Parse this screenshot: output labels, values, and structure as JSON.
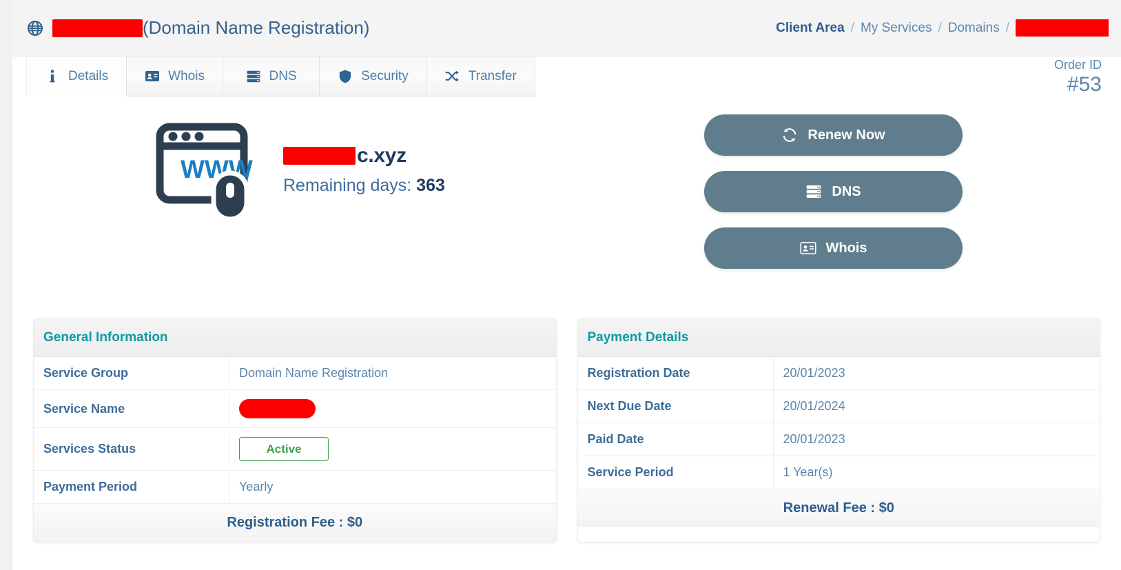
{
  "header": {
    "globe_icon": "globe-icon",
    "title_redacted": true,
    "title_suffix": "(Domain Name Registration)",
    "breadcrumb": {
      "items": [
        {
          "label": "Client Area",
          "strong": true
        },
        {
          "label": "My Services",
          "strong": false
        },
        {
          "label": "Domains",
          "strong": false
        }
      ],
      "separator": "/",
      "last_redacted": true
    }
  },
  "tabs": [
    {
      "label": "Details",
      "icon": "info-icon",
      "active": true
    },
    {
      "label": "Whois",
      "icon": "id-card-icon",
      "active": false
    },
    {
      "label": "DNS",
      "icon": "server-icon",
      "active": false
    },
    {
      "label": "Security",
      "icon": "shield-icon",
      "active": false
    },
    {
      "label": "Transfer",
      "icon": "shuffle-icon",
      "active": false
    }
  ],
  "order": {
    "label": "Order ID",
    "value": "#53"
  },
  "hero": {
    "www_icon": "www-browser-mouse-icon",
    "domain_suffix": "c.xyz",
    "remaining_label": "Remaining days:",
    "remaining_value": "363",
    "actions": [
      {
        "label": "Renew Now",
        "icon": "refresh-icon"
      },
      {
        "label": "DNS",
        "icon": "server-icon"
      },
      {
        "label": "Whois",
        "icon": "id-card-icon"
      }
    ]
  },
  "general_information": {
    "title": "General Information",
    "rows": [
      {
        "label": "Service Group",
        "value": "Domain Name Registration",
        "type": "text"
      },
      {
        "label": "Service Name",
        "value": "",
        "type": "redacted"
      },
      {
        "label": "Services Status",
        "value": "Active",
        "type": "badge"
      },
      {
        "label": "Payment Period",
        "value": "Yearly",
        "type": "text"
      }
    ],
    "footer": "Registration Fee : $0"
  },
  "payment_details": {
    "title": "Payment Details",
    "rows": [
      {
        "label": "Registration Date",
        "value": "20/01/2023",
        "type": "text"
      },
      {
        "label": "Next Due Date",
        "value": "20/01/2024",
        "type": "text"
      },
      {
        "label": "Paid Date",
        "value": "20/01/2023",
        "type": "text"
      },
      {
        "label": "Service Period",
        "value": "1 Year(s)",
        "type": "text"
      }
    ],
    "footer": "Renewal Fee : $0"
  },
  "colors": {
    "accent_teal": "#0d9aa5",
    "link_blue": "#4d7ea8",
    "heading_blue": "#3e6c99",
    "button_slate": "#5f7d8c",
    "status_green": "#3fa14a",
    "redaction_red": "#fc0000"
  }
}
